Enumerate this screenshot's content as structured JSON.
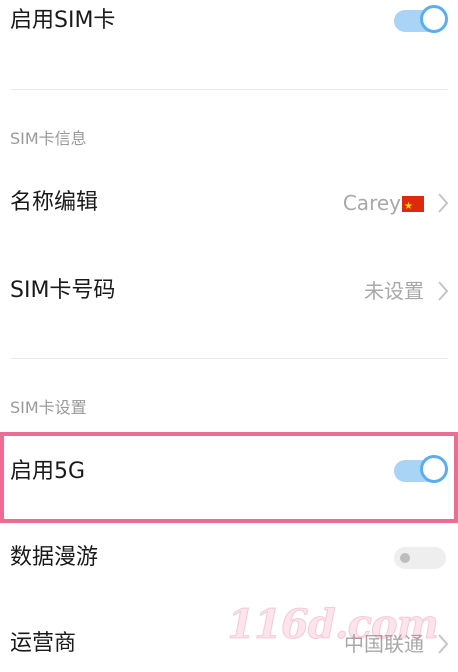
{
  "enable_sim": {
    "label": "启用SIM卡",
    "toggle_state": "on"
  },
  "sim_info": {
    "header": "SIM卡信息",
    "name_edit": {
      "label": "名称编辑",
      "value": "Carey",
      "flag_icon": "china-flag-icon"
    },
    "sim_number": {
      "label": "SIM卡号码",
      "value": "未设置"
    }
  },
  "sim_settings": {
    "header": "SIM卡设置",
    "enable_5g": {
      "label": "启用5G",
      "toggle_state": "on"
    },
    "data_roaming": {
      "label": "数据漫游",
      "toggle_state": "off"
    },
    "carrier": {
      "label": "运营商",
      "value": "中国联通"
    }
  },
  "watermark": "116d.com",
  "colors": {
    "toggle_on_track": "#a9d4f5",
    "toggle_on_ring": "#5aaef0",
    "highlight_border": "#ee6c93",
    "secondary_text": "#a8a8a8"
  }
}
